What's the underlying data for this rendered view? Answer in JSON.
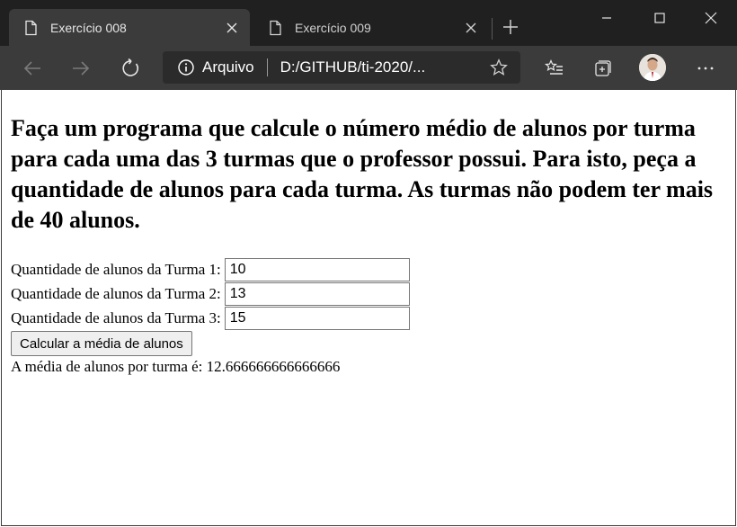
{
  "browser": {
    "tabs": [
      {
        "title": "Exercício 008",
        "active": true
      },
      {
        "title": "Exercício 009",
        "active": false
      }
    ],
    "address": {
      "site_label": "Arquivo",
      "url": "D:/GITHUB/ti-2020/..."
    },
    "icons": {
      "back": "back-arrow-icon",
      "forward": "forward-arrow-icon",
      "refresh": "refresh-icon",
      "info": "info-icon",
      "favorite": "star-icon",
      "favorites_list": "favorites-list-icon",
      "collections": "collections-icon",
      "more": "more-icon"
    },
    "colors": {
      "tabstrip": "#202020",
      "toolbar": "#3b3b3b",
      "address_bg": "#2b2b2b"
    }
  },
  "page": {
    "heading": "Faça um programa que calcule o número médio de alunos por turma para cada uma das 3 turmas que o professor possui. Para isto, peça a quantidade de alunos para cada turma. As turmas não podem ter mais de 40 alunos.",
    "fields": [
      {
        "label": "Quantidade de alunos da Turma 1:",
        "value": "10"
      },
      {
        "label": "Quantidade de alunos da Turma 2:",
        "value": "13"
      },
      {
        "label": "Quantidade de alunos da Turma 3:",
        "value": "15"
      }
    ],
    "button_label": "Calcular a média de alunos",
    "result_text": "A média de alunos por turma é: 12.666666666666666"
  }
}
